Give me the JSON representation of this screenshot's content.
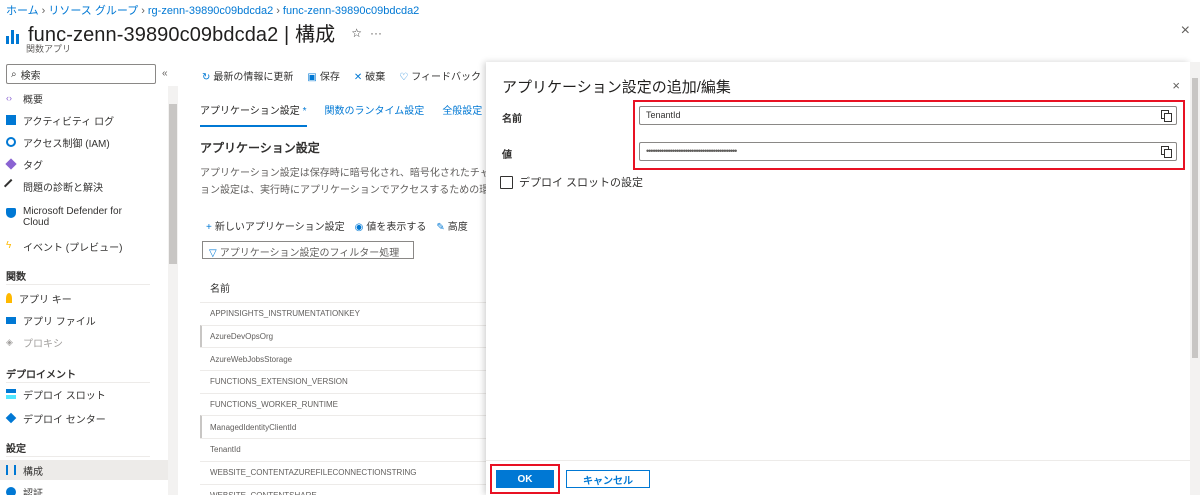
{
  "breadcrumb": [
    "ホーム",
    "リソース グループ",
    "rg-zenn-39890c09bdcda2",
    "func-zenn-39890c09bdcda2"
  ],
  "header": {
    "title": "func-zenn-39890c09bdcda2 | 構成",
    "subtitle": "関数アプリ",
    "star": "☆",
    "more": "···",
    "close": "×"
  },
  "sidebar": {
    "search_placeholder": "検索",
    "collapse": "«",
    "items": [
      {
        "label": "概要",
        "icon": "overview-icon",
        "color": "#8a63d2"
      },
      {
        "label": "アクティビティ ログ",
        "icon": "activity-log-icon",
        "color": "#0078d4"
      },
      {
        "label": "アクセス制御 (IAM)",
        "icon": "iam-icon",
        "color": "#0078d4"
      },
      {
        "label": "タグ",
        "icon": "tag-icon",
        "color": "#8a63d2"
      },
      {
        "label": "問題の診断と解決",
        "icon": "wrench-icon",
        "color": "#323130"
      },
      {
        "label": "Microsoft Defender for Cloud",
        "icon": "shield-icon",
        "color": "#0078d4"
      },
      {
        "label": "イベント (プレビュー)",
        "icon": "lightning-icon",
        "color": "#ffb900"
      }
    ],
    "section_functions": "関数",
    "functions_items": [
      {
        "label": "アプリ キー",
        "icon": "key-icon",
        "color": "#ffb900"
      },
      {
        "label": "アプリ ファイル",
        "icon": "file-icon",
        "color": "#0078d4"
      },
      {
        "label": "プロキシ",
        "icon": "proxy-icon",
        "color": "#a19f9d"
      }
    ],
    "section_deploy": "デプロイメント",
    "deploy_items": [
      {
        "label": "デプロイ スロット",
        "icon": "slot-icon",
        "color": "#0078d4"
      },
      {
        "label": "デプロイ センター",
        "icon": "cube-icon",
        "color": "#0078d4"
      }
    ],
    "section_settings": "設定",
    "settings_items": [
      {
        "label": "構成",
        "icon": "config-icon",
        "color": "#0078d4"
      },
      {
        "label": "認証",
        "icon": "auth-icon",
        "color": "#0078d4"
      }
    ]
  },
  "toolbar": {
    "refresh": "最新の情報に更新",
    "save": "保存",
    "discard": "破棄",
    "feedback": "フィードバック"
  },
  "tabs": [
    "アプリケーション設定",
    "関数のランタイム設定",
    "全般設定"
  ],
  "tab_active_marker": "*",
  "main": {
    "section_title": "アプリケーション設定",
    "desc_line1": "アプリケーション設定は保存時に暗号化され、暗号化されたチャネル",
    "desc_line2": "ョン設定は、実行時にアプリケーションでアクセスするための環境",
    "new_setting": "新しいアプリケーション設定",
    "show_values": "値を表示する",
    "advanced": "高度",
    "filter_placeholder": "アプリケーション設定のフィルター処理",
    "col_name": "名前",
    "rows": [
      "APPINSIGHTS_INSTRUMENTATIONKEY",
      "AzureDevOpsOrg",
      "AzureWebJobsStorage",
      "FUNCTIONS_EXTENSION_VERSION",
      "FUNCTIONS_WORKER_RUNTIME",
      "ManagedIdentityClientId",
      "TenantId",
      "WEBSITE_CONTENTAZUREFILECONNECTIONSTRING",
      "WEBSITE_CONTENTSHARE"
    ]
  },
  "panel": {
    "title": "アプリケーション設定の追加/編集",
    "close": "×",
    "name_label": "名前",
    "name_value": "TenantId",
    "value_label": "値",
    "value_value": "••••••••••••••••••••••••••••••••••••••••••",
    "slot_checkbox": "デプロイ スロットの設定",
    "ok": "OK",
    "cancel": "キャンセル"
  }
}
